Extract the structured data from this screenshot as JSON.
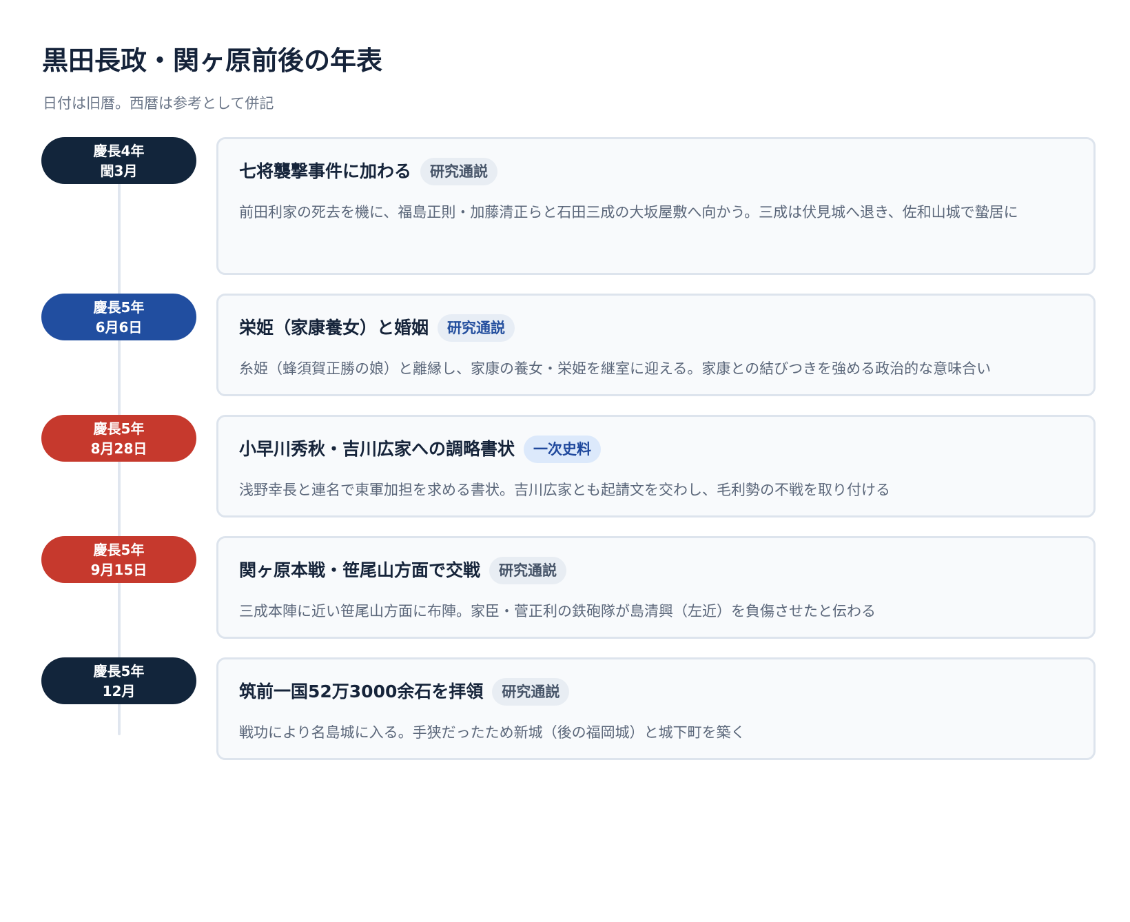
{
  "header": {
    "title": "黒田長政・関ヶ原前後の年表",
    "subtitle": "日付は旧暦。西暦は参考として併記"
  },
  "colors": {
    "navy": "#12253b",
    "blue": "#214ea0",
    "red": "#c6392d",
    "card_background": "#f8fafc",
    "card_border": "#dde4ed",
    "timeline_line": "#e0e6ef"
  },
  "events": [
    {
      "date_year": "慶長4年",
      "date_month": "閏3月",
      "date_color": "navy",
      "title": "七将襲撃事件に加わる",
      "badge": "研究通説",
      "description": "前田利家の死去を機に、福島正則・加藤清正らと石田三成の大坂屋敷へ向かう。三成は伏見城へ退き、佐和山城で蟄居に"
    },
    {
      "date_year": "慶長5年",
      "date_month": "6月6日",
      "date_color": "blue",
      "title": "栄姫（家康養女）と婚姻",
      "badge": "研究通説",
      "description": "糸姫（蜂須賀正勝の娘）と離縁し、家康の養女・栄姫を継室に迎える。家康との結びつきを強める政治的な意味合い"
    },
    {
      "date_year": "慶長5年",
      "date_month": "8月28日",
      "date_color": "red",
      "title": "小早川秀秋・吉川広家への調略書状",
      "badge": "一次史料",
      "description": "浅野幸長と連名で東軍加担を求める書状。吉川広家とも起請文を交わし、毛利勢の不戦を取り付ける"
    },
    {
      "date_year": "慶長5年",
      "date_month": "9月15日",
      "date_color": "red",
      "title": "関ヶ原本戦・笹尾山方面で交戦",
      "badge": "研究通説",
      "description": "三成本陣に近い笹尾山方面に布陣。家臣・菅正利の鉄砲隊が島清興（左近）を負傷させたと伝わる"
    },
    {
      "date_year": "慶長5年",
      "date_month": "12月",
      "date_color": "navy",
      "title": "筑前一国52万3000余石を拝領",
      "badge": "研究通説",
      "description": "戦功により名島城に入る。手狭だったため新城（後の福岡城）と城下町を築く"
    }
  ]
}
